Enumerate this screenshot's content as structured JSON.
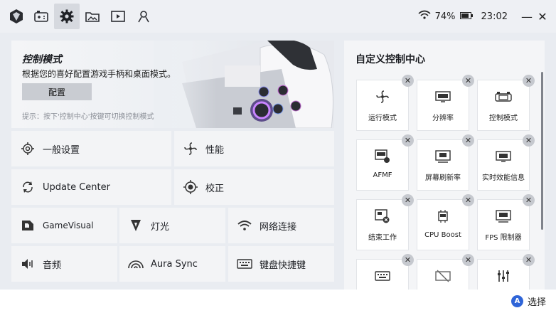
{
  "status": {
    "battery": "74%",
    "time": "23:02"
  },
  "nav": {
    "items": [
      {
        "name": "logo",
        "icon": "armoury-logo-icon"
      },
      {
        "name": "game-library",
        "icon": "gamepad-icon"
      },
      {
        "name": "settings",
        "icon": "gear-icon"
      },
      {
        "name": "media",
        "icon": "image-folder-icon"
      },
      {
        "name": "video",
        "icon": "play-box-icon"
      },
      {
        "name": "community",
        "icon": "person-icon"
      }
    ]
  },
  "hero": {
    "title": "控制模式",
    "desc": "根据您的喜好配置游戏手柄和桌面模式。",
    "button": "配置",
    "hint": "提示：按下'控制中心'按键可切换控制模式"
  },
  "tiles": {
    "general": "一般设置",
    "performance": "性能",
    "update_center": "Update Center",
    "calibration": "校正",
    "gamevisual": "GameVisual",
    "lighting": "灯光",
    "network": "网络连接",
    "audio": "音频",
    "aura_sync": "Aura Sync",
    "keyboard_shortcuts": "键盘快捷键"
  },
  "control_center": {
    "title": "自定义控制中心",
    "cards": [
      {
        "label": "运行模式",
        "icon": "fan-icon"
      },
      {
        "label": "分辨率",
        "icon": "fhd-icon"
      },
      {
        "label": "控制模式",
        "icon": "controller-icon"
      },
      {
        "label": "AFMF",
        "icon": "fps-settings-icon"
      },
      {
        "label": "屏幕刷新率",
        "icon": "hz-icon"
      },
      {
        "label": "实时效能信息",
        "icon": "info-icon"
      },
      {
        "label": "结束工作",
        "icon": "end-task-icon"
      },
      {
        "label": "CPU Boost",
        "icon": "cpu-icon"
      },
      {
        "label": "FPS 限制器",
        "icon": "fps-limiter-icon"
      },
      {
        "label": "",
        "icon": "keyboard-icon"
      },
      {
        "label": "",
        "icon": "touch-disable-icon"
      },
      {
        "label": "",
        "icon": "equalizer-icon"
      }
    ]
  },
  "footer": {
    "a_label": "A",
    "select": "选择"
  }
}
